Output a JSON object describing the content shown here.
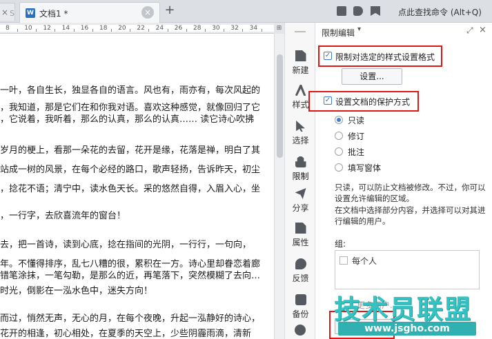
{
  "tabs": {
    "prev_tab_glyph": "S",
    "doc_tab_label": "文档1 *",
    "doc_icon_letter": "W",
    "close_glyph": "×",
    "add_glyph": "+"
  },
  "top_right": {
    "search_command": "点此查找命令 (Alt+Q)"
  },
  "ruler": {
    "ticks": [
      "8",
      "10",
      "12",
      "14",
      "16",
      "18",
      "20",
      "22",
      "24",
      "26",
      "28",
      "30",
      "32",
      "34"
    ],
    "corner": "⊞"
  },
  "document": {
    "lines": [
      "一叶，各自生长，独显各自的语言。风也有，雨亦有，每次风起的",
      "，我知道，那是它们在和你我对语。喜欢这种感觉，就像回归了它",
      "，它说着，我听着，那么的认真，那么的认真……  读它诗心吹拂",
      "岁月的梗上，看那一朵花的去留，花开是缘，花落是禅，明白了其",
      "站成一树的风景，在每个必经的路口，歌声轻扬，告诉昨天，初尘",
      "，捻花不语；清宁中，读水色天长。采的悠然自得，入眉入心，坐",
      "，一行字，去欣喜流年的窗台！",
      "去，把一首诗，读到心底，捻在指间的光阴，一行行，一句向，",
      "年。不懂得排序，乱七八糟的很，累积在一方。诗心里却眷恋着廊",
      "错笔涂抹，一笔勾勒，是那么的近，再笔落下，突然模糊了去向…",
      "时光，倒影在一泓水色中，迷失方向！",
      "而过，悄然无声，无心的月，在每个夜晚，升起一泓静好的诗心，",
      "花开的相逢，初心相处，在夏季的天空上，少些阴霾雨滴，清新"
    ]
  },
  "toolbar": {
    "items": [
      {
        "label": "新建",
        "icon": "new-doc-icon"
      },
      {
        "label": "样式",
        "icon": "style-icon"
      },
      {
        "label": "选择",
        "icon": "select-cursor-icon"
      },
      {
        "label": "限制",
        "icon": "lock-icon"
      },
      {
        "label": "分享",
        "icon": "share-icon"
      },
      {
        "label": "属性",
        "icon": "properties-icon"
      },
      {
        "label": "反馈",
        "icon": "feedback-icon"
      },
      {
        "label": "备份",
        "icon": "backup-icon"
      }
    ],
    "active": "限制"
  },
  "pane": {
    "title": "限制编辑",
    "caret": "▾",
    "pin_glyph": "⤢",
    "close_glyph": "×",
    "restrict_format_label": "限制对选定的样式设置格式",
    "restrict_format_checked": true,
    "settings_button": "设置...",
    "protect_label": "设置文档的保护方式",
    "protect_checked": true,
    "radio_options": [
      "只读",
      "修订",
      "批注",
      "填写窗体"
    ],
    "radio_selected": "只读",
    "desc1": "只读，可以防止文档被修改。不过，你可以设置允许编辑的区域。",
    "desc2": "在文档中选择部分内容，并选择可以对其进行编辑的用户。",
    "groups_label": "组:",
    "everyone_label": "每个人",
    "more_users": "更多用户...",
    "check_glyph": "✓",
    "accent_color": "#3c7dd2",
    "highlight_color": "#e01515"
  },
  "watermark": {
    "text": "技术员联盟",
    "url": "www.jsgho.com"
  }
}
